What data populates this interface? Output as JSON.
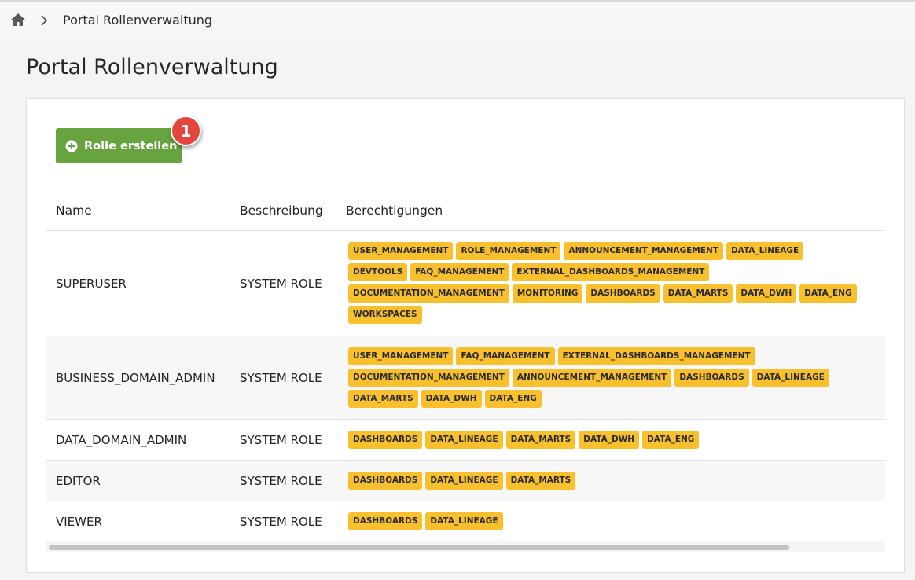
{
  "breadcrumb": {
    "home_icon": "home-icon",
    "separator_icon": "chevron-right-icon",
    "current": "Portal Rollenverwaltung"
  },
  "page": {
    "title": "Portal Rollenverwaltung"
  },
  "toolbar": {
    "create_label": "Rolle erstellen",
    "create_icon": "plus-circle-icon",
    "badge_count": "1",
    "button_color": "#67a33e",
    "badge_color": "#e2463c"
  },
  "table": {
    "headers": {
      "name": "Name",
      "description": "Beschreibung",
      "permissions": "Berechtigungen"
    },
    "tag_color": "#f9c02e",
    "rows": [
      {
        "name": "SUPERUSER",
        "description": "SYSTEM ROLE",
        "permissions": [
          "USER_MANAGEMENT",
          "ROLE_MANAGEMENT",
          "ANNOUNCEMENT_MANAGEMENT",
          "DATA_LINEAGE",
          "DEVTOOLS",
          "FAQ_MANAGEMENT",
          "EXTERNAL_DASHBOARDS_MANAGEMENT",
          "DOCUMENTATION_MANAGEMENT",
          "MONITORING",
          "DASHBOARDS",
          "DATA_MARTS",
          "DATA_DWH",
          "DATA_ENG",
          "WORKSPACES"
        ]
      },
      {
        "name": "BUSINESS_DOMAIN_ADMIN",
        "description": "SYSTEM ROLE",
        "permissions": [
          "USER_MANAGEMENT",
          "FAQ_MANAGEMENT",
          "EXTERNAL_DASHBOARDS_MANAGEMENT",
          "DOCUMENTATION_MANAGEMENT",
          "ANNOUNCEMENT_MANAGEMENT",
          "DASHBOARDS",
          "DATA_LINEAGE",
          "DATA_MARTS",
          "DATA_DWH",
          "DATA_ENG"
        ]
      },
      {
        "name": "DATA_DOMAIN_ADMIN",
        "description": "SYSTEM ROLE",
        "permissions": [
          "DASHBOARDS",
          "DATA_LINEAGE",
          "DATA_MARTS",
          "DATA_DWH",
          "DATA_ENG"
        ]
      },
      {
        "name": "EDITOR",
        "description": "SYSTEM ROLE",
        "permissions": [
          "DASHBOARDS",
          "DATA_LINEAGE",
          "DATA_MARTS"
        ]
      },
      {
        "name": "VIEWER",
        "description": "SYSTEM ROLE",
        "permissions": [
          "DASHBOARDS",
          "DATA_LINEAGE"
        ]
      }
    ]
  }
}
